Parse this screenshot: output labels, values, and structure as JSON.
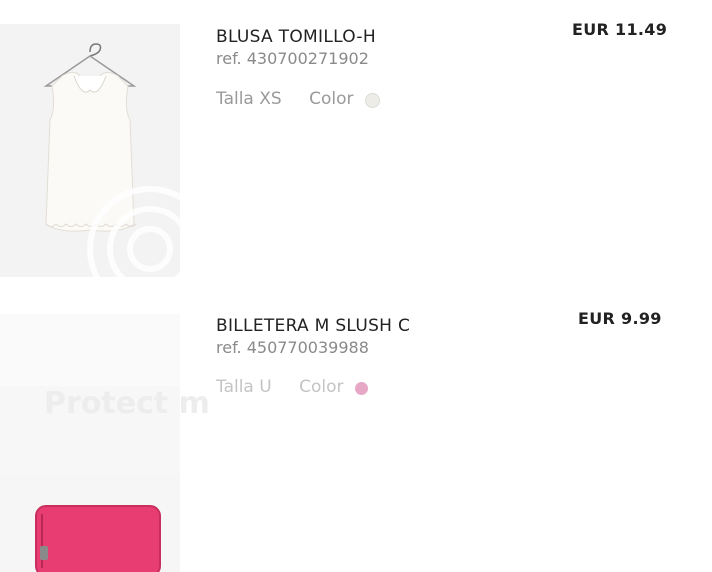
{
  "items": [
    {
      "name": "BLUSA TOMILLO-H",
      "ref": "ref. 430700271902",
      "size_label": "Talla XS",
      "color_label": "Color",
      "color_swatch": "#eeece6",
      "price": "EUR 11.49",
      "image": "white sleeveless blouse on hanger"
    },
    {
      "name": "BILLETERA M SLUSH C",
      "ref": "ref. 450770039988",
      "size_label": "Talla U",
      "color_label": "Color",
      "color_swatch": "#e7a8c8",
      "price": "EUR 9.99",
      "image": "pink zip wallet"
    }
  ],
  "watermark": "Protect m"
}
